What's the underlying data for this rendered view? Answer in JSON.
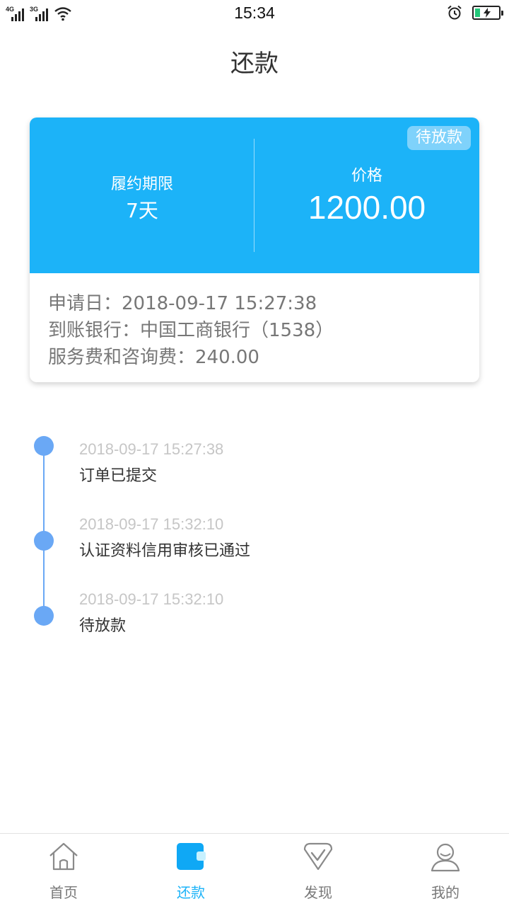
{
  "status_bar": {
    "time": "15:34",
    "signal_1_tag": "4G",
    "signal_2_tag": "3G",
    "battery_color": "#23c87a"
  },
  "header": {
    "title": "还款"
  },
  "card": {
    "accent_color": "#1cb3f8",
    "badge": "待放款",
    "term_label": "履约期限",
    "term_value": "7天",
    "price_label": "价格",
    "price_value": "1200.00",
    "apply_date": "申请日：2018-09-17 15:27:38",
    "bank": "到账银行：中国工商银行（1538）",
    "fee": "服务费和咨询费：240.00"
  },
  "timeline": {
    "dot_color": "#6aa8f5",
    "items": [
      {
        "time": "2018-09-17 15:27:38",
        "text": "订单已提交"
      },
      {
        "time": "2018-09-17 15:32:10",
        "text": "认证资料信用审核已通过"
      },
      {
        "time": "2018-09-17 15:32:10",
        "text": "待放款"
      }
    ]
  },
  "bottom_nav": {
    "active": "repay",
    "items": [
      {
        "key": "home",
        "label": "首页",
        "icon": "home-icon"
      },
      {
        "key": "repay",
        "label": "还款",
        "icon": "wallet-icon"
      },
      {
        "key": "discover",
        "label": "发现",
        "icon": "discover-icon"
      },
      {
        "key": "mine",
        "label": "我的",
        "icon": "user-icon"
      }
    ]
  }
}
